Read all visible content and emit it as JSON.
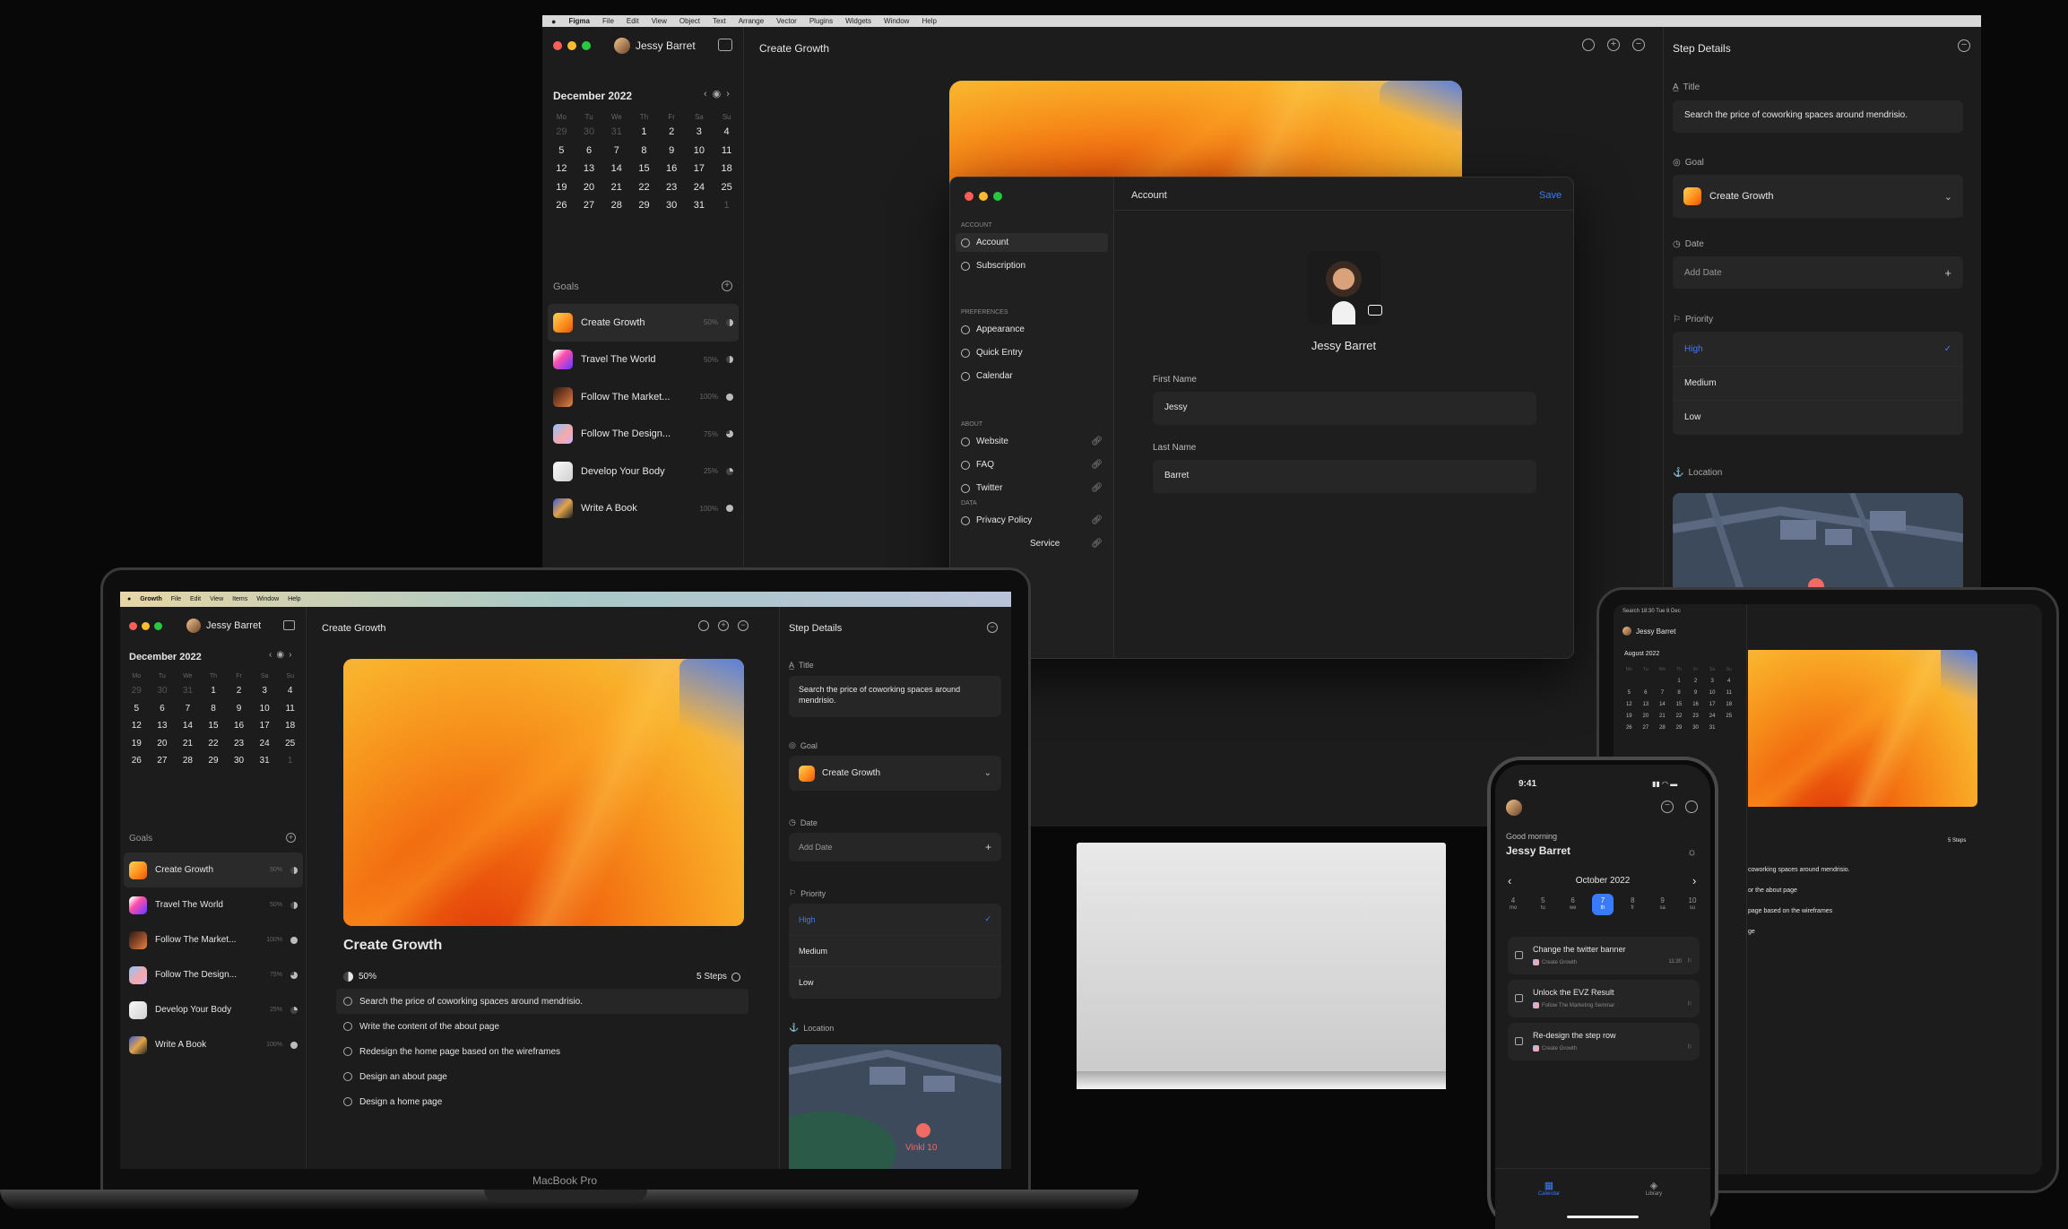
{
  "menubar": {
    "app": "Figma",
    "items": [
      "File",
      "Edit",
      "View",
      "Object",
      "Text",
      "Arrange",
      "Vector",
      "Plugins",
      "Widgets",
      "Window",
      "Help"
    ]
  },
  "user": {
    "name": "Jessy Barret",
    "first_name": "Jessy",
    "last_name": "Barret"
  },
  "calendar": {
    "month": "December 2022",
    "weekdays": [
      "Mo",
      "Tu",
      "We",
      "Th",
      "Fr",
      "Sa",
      "Su"
    ],
    "weeks": [
      [
        "29",
        "30",
        "31",
        "1",
        "2",
        "3",
        "4"
      ],
      [
        "5",
        "6",
        "7",
        "8",
        "9",
        "10",
        "11"
      ],
      [
        "12",
        "13",
        "14",
        "15",
        "16",
        "17",
        "18"
      ],
      [
        "19",
        "20",
        "21",
        "22",
        "23",
        "24",
        "25"
      ],
      [
        "26",
        "27",
        "28",
        "29",
        "30",
        "31",
        "1"
      ]
    ]
  },
  "goals": {
    "heading": "Goals",
    "items": [
      {
        "name": "Create Growth",
        "name_short": "Create Growth",
        "pct": "50%",
        "progress": 0.5,
        "thumb": "orange"
      },
      {
        "name": "Travel The World",
        "name_short": "Travel The World",
        "pct": "50%",
        "progress": 0.5,
        "thumb": "pink"
      },
      {
        "name": "Follow The Market...",
        "name_short": "Follow The Market...",
        "pct": "100%",
        "progress": 1,
        "thumb": "brown"
      },
      {
        "name": "Follow The Design...",
        "name_short": "Follow The Design...",
        "pct": "75%",
        "progress": 0.75,
        "thumb": "blue"
      },
      {
        "name": "Develop Your Body",
        "name_short": "Develop Your Body",
        "pct": "25%",
        "progress": 0.25,
        "thumb": "white"
      },
      {
        "name": "Write A Book",
        "name_short": "Write A Book",
        "pct": "100%",
        "progress": 1,
        "thumb": "mix"
      }
    ]
  },
  "main": {
    "title": "Create Growth",
    "progress_label": "50%",
    "progress": 0.5,
    "steps_label": "5 Steps",
    "steps": [
      "Search the price of coworking spaces around mendrisio.",
      "Write the content of the about page",
      "Redesign the home page based on the wireframes",
      "Design an about page",
      "Design a home page"
    ]
  },
  "details": {
    "heading": "Step Details",
    "title_label": "Title",
    "title_value": "Search the price of coworking spaces around mendrisio.",
    "goal_label": "Goal",
    "goal_value": "Create Growth",
    "date_label": "Date",
    "date_placeholder": "Add Date",
    "priority_label": "Priority",
    "priorities": [
      "High",
      "Medium",
      "Low"
    ],
    "priority_selected": "High",
    "location_label": "Location",
    "map_place": "Vinkl 10"
  },
  "settings": {
    "title": "Account",
    "save": "Save",
    "sections": [
      {
        "heading": "ACCOUNT",
        "items": [
          "Account",
          "Subscription"
        ]
      },
      {
        "heading": "PREFERENCES",
        "items": [
          "Appearance",
          "Quick Entry",
          "Calendar"
        ]
      },
      {
        "heading": "ABOUT",
        "items": [
          "Website",
          "FAQ",
          "Twitter"
        ]
      },
      {
        "heading": "DATA",
        "items": [
          "Privacy Policy",
          "Service"
        ]
      }
    ],
    "first_name_label": "First Name",
    "last_name_label": "Last Name"
  },
  "laptop": {
    "menubar_app": "Growth",
    "menu_items": [
      "File",
      "Edit",
      "View",
      "Items",
      "Window",
      "Help"
    ],
    "label": "MacBook Pro"
  },
  "phone": {
    "time": "9:41",
    "greeting": "Good morning",
    "name": "Jessy Barret",
    "month": "October 2022",
    "days": [
      {
        "n": "4",
        "d": "mo"
      },
      {
        "n": "5",
        "d": "tu"
      },
      {
        "n": "6",
        "d": "we"
      },
      {
        "n": "7",
        "d": "th"
      },
      {
        "n": "8",
        "d": "fr"
      },
      {
        "n": "9",
        "d": "sa"
      },
      {
        "n": "10",
        "d": "su"
      }
    ],
    "tasks": [
      {
        "title": "Change the twitter banner",
        "goal": "Create Growth",
        "time": "11:30"
      },
      {
        "title": "Unlock the EVZ Result",
        "goal": "Follow The Marketing Seminar",
        "time": ""
      },
      {
        "title": "Re-design the step row",
        "goal": "Create Growth",
        "time": ""
      }
    ],
    "tabs": [
      "Calendar",
      "Library"
    ]
  },
  "tablet": {
    "status_left": "Search  18:30  Tue 8 Dec",
    "month": "August 2022",
    "steps_label": "5 Steps",
    "rows": [
      "1",
      "2",
      "3",
      "4",
      "5",
      "6",
      "7",
      "8",
      "9",
      "10",
      "11",
      "12",
      "13",
      "14",
      "15",
      "16",
      "17",
      "18",
      "19",
      "20",
      "21",
      "22",
      "23",
      "24",
      "25",
      "26",
      "27",
      "28",
      "29",
      "30",
      "31"
    ],
    "steps": [
      "coworking spaces around mendrisio.",
      "or the about page",
      "page based on the wireframes",
      "ge"
    ]
  },
  "colors": {
    "accent": "#3a7bfd",
    "bg": "#1c1c1c",
    "panel": "#202020"
  }
}
